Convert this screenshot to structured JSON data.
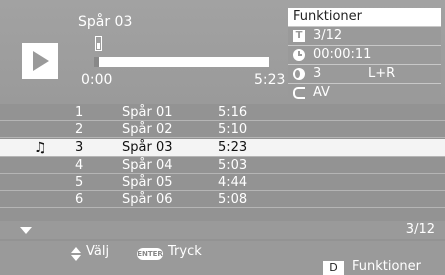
{
  "player": {
    "track_title": "Spår 03",
    "time_start": "0:00",
    "time_end": "5:23",
    "progress_fraction": 0.03
  },
  "functions": {
    "header": "Funktioner",
    "title_icon": "T",
    "title_value": "3/12",
    "time_value": "00:00:11",
    "audio_value": "3",
    "audio_channel": "L+R",
    "repeat_value": "AV"
  },
  "tracks": [
    {
      "num": "1",
      "name": "Spår 01",
      "duration": "5:16"
    },
    {
      "num": "2",
      "name": "Spår 02",
      "duration": "5:10"
    },
    {
      "num": "3",
      "name": "Spår 03",
      "duration": "5:23",
      "selected": true
    },
    {
      "num": "4",
      "name": "Spår 04",
      "duration": "5:03"
    },
    {
      "num": "5",
      "name": "Spår 05",
      "duration": "4:44"
    },
    {
      "num": "6",
      "name": "Spår 06",
      "duration": "5:08"
    }
  ],
  "page_indicator": "3/12",
  "footer": {
    "select_label": "Välj",
    "enter_key": "ENTER",
    "press_label": "Tryck",
    "d_key": "D",
    "functions_label": "Funktioner"
  }
}
